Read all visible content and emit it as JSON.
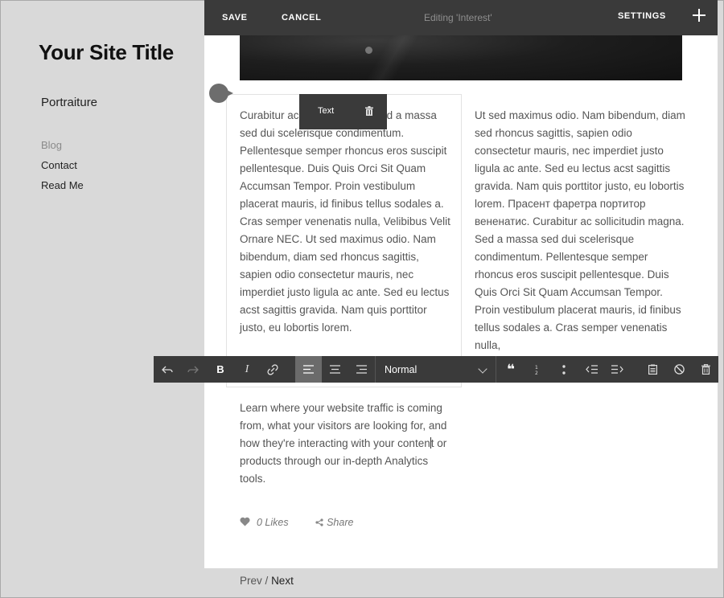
{
  "sidebar": {
    "site_title": "Your Site Title",
    "section": "Portraiture",
    "nav": [
      "Blog",
      "Contact",
      "Read Me"
    ]
  },
  "topbar": {
    "save": "SAVE",
    "cancel": "CANCEL",
    "editing": "Editing 'Interest'",
    "settings": "SETTINGS"
  },
  "block_popup": {
    "label": "Text"
  },
  "content": {
    "left_start": "Curabitur ac",
    "left_mid": "na. Sed a massa sed dui scelerisque condimentum. Pellentesque semper rhoncus eros suscipit pellentesque. Duis Quis Orci Sit Quam Accumsan Tempor. Proin vestibulum placerat mauris, id finibus tellus sodales a. Cras semper venenatis nulla, Velibibus Velit Ornare NEC. Ut sed maximus odio. Nam bibendum, diam sed rhoncus sagittis, sapien odio consectetur mauris, nec imperdiet justo ligula ac ante. Sed eu lectus acst sagittis gravida. Nam quis porttitor justo, eu lobortis lorem.",
    "right": "Ut sed maximus odio. Nam bibendum, diam sed rhoncus sagittis, sapien odio consectetur mauris, nec imperdiet justo ligula ac ante. Sed eu lectus acst sagittis gravida. Nam quis porttitor justo, eu lobortis lorem. Прасент фаретра портитор вененатис. Curabitur ac sollicitudin magna. Sed a massa sed dui scelerisque condimentum. Pellentesque semper rhoncus eros suscipit pellentesque. Duis Quis Orci Sit Quam Accumsan Tempor. Proin vestibulum placerat mauris, id finibus tellus sodales a. Cras semper venenatis nulla,",
    "bottom_before_cursor": "Learn where your website traffic is coming from, what your visitors are looking for, and how they're interacting with your conten",
    "bottom_after_cursor": "t or products through our in-depth Analytics tools."
  },
  "toolbar": {
    "style_select": "Normal",
    "bold": "B",
    "italic": "I",
    "quote": "❝",
    "active_align": "align-left"
  },
  "meta": {
    "likes": "0 Likes",
    "share": "Share"
  },
  "pager": {
    "prev": "Prev",
    "separator": "/",
    "next": "Next"
  }
}
